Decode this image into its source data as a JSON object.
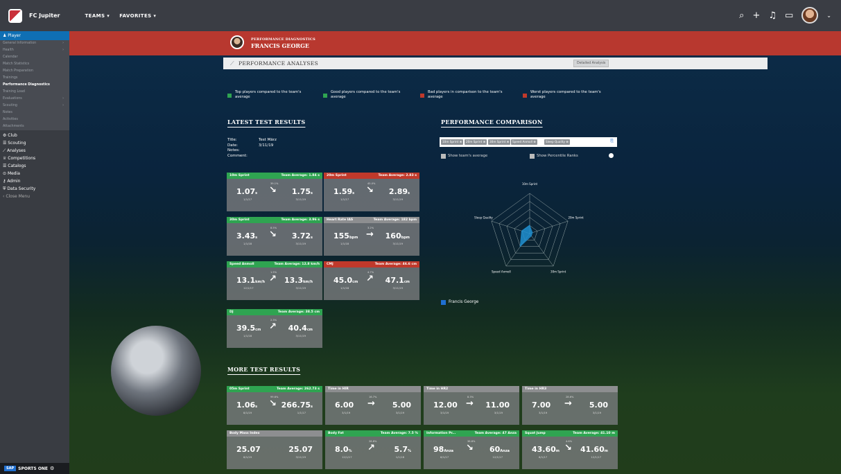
{
  "header": {
    "brand": "FC Jupiter",
    "nav": [
      "TEAMS ▾",
      "FAVORITES ▾"
    ],
    "icons": [
      "search-icon",
      "plus-icon",
      "whistle-icon",
      "chat-icon"
    ]
  },
  "sidebar": {
    "player_label": "Player",
    "sub": [
      "General Information",
      "Health",
      "Calendar",
      "Match Statistics",
      "Match Preparation",
      "Trainings",
      "Performance Diagnostics",
      "Training Load",
      "Evaluations",
      "Scouting",
      "Notes",
      "Activities",
      "Attachments"
    ],
    "main": [
      "Club",
      "Scouting",
      "Analyses",
      "Competitions",
      "Catalogs",
      "Media",
      "Admin",
      "Data Security",
      "Close Menu"
    ],
    "footer": "SPORTS ONE",
    "footer_logo": "SAP"
  },
  "banner": {
    "subtitle": "PERFORMANCE DIAGNOSTICS",
    "title": "FRANCIS GEORGE"
  },
  "subbar": {
    "title": "PERFORMANCE ANALYSES",
    "detail_button": "Detailed Analysis"
  },
  "legend": [
    {
      "color": "#2fa451",
      "text": "Top players compared to the team's average"
    },
    {
      "color": "#2fa451",
      "text": "Good players compared to the team's average"
    },
    {
      "color": "#c0392b",
      "text": "Bad players in comparison to the team's average"
    },
    {
      "color": "#c0392b",
      "text": "Worst players compared to the team's average"
    }
  ],
  "latest": {
    "title": "LATEST TEST RESULTS",
    "meta": [
      {
        "k": "Title:",
        "v": "Test März"
      },
      {
        "k": "Date:",
        "v": "3/11/19"
      },
      {
        "k": "Notes:",
        "v": ""
      },
      {
        "k": "Comment:",
        "v": ""
      }
    ]
  },
  "cards": [
    {
      "name": "10m Sprint",
      "avg": "Team Average: 1.84 s",
      "color": "green",
      "v1": "1.07",
      "u1": "s",
      "v2": "1.75",
      "u2": "s",
      "d1": "1/1/17",
      "d2": "3/11/19",
      "pct": "39.1%",
      "dir": "down"
    },
    {
      "name": "20m Sprint",
      "avg": "Team Average: 2.83 s",
      "color": "red",
      "v1": "1.59",
      "u1": "s",
      "v2": "2.89",
      "u2": "s",
      "d1": "1/1/17",
      "d2": "3/11/19",
      "pct": "45.0%",
      "dir": "down"
    },
    {
      "name": "30m Sprint",
      "avg": "Team Average: 3.96 s",
      "color": "green",
      "v1": "3.43",
      "u1": "s",
      "v2": "3.72",
      "u2": "s",
      "d1": "1/1/18",
      "d2": "3/11/19",
      "pct": "8.5%",
      "dir": "down"
    },
    {
      "name": "Heart Rate IAS",
      "avg": "Team Average: 182 bpm",
      "color": "gray",
      "v1": "155",
      "u1": "bpm",
      "v2": "160",
      "u2": "bpm",
      "d1": "1/1/18",
      "d2": "3/11/19",
      "pct": "3.2%",
      "dir": "flat"
    },
    {
      "name": "Speed Anmoll",
      "avg": "Team Average: 12.8 km/h",
      "color": "green",
      "v1": "13.1",
      "u1": "km/h",
      "v2": "13.3",
      "u2": "km/h",
      "d1": "12/1/17",
      "d2": "3/11/19",
      "pct": "1.5%",
      "dir": "up"
    },
    {
      "name": "CMJ",
      "avg": "Team Average: 46.6 cm",
      "color": "red",
      "v1": "45.0",
      "u1": "cm",
      "v2": "47.1",
      "u2": "cm",
      "d1": "1/1/18",
      "d2": "3/11/19",
      "pct": "4.7%",
      "dir": "up"
    },
    {
      "name": "DJ",
      "avg": "Team Average: 38.5 cm",
      "color": "green",
      "v1": "39.5",
      "u1": "cm",
      "v2": "40.4",
      "u2": "cm",
      "d1": "1/1/18",
      "d2": "3/11/19",
      "pct": "2.3%",
      "dir": "up"
    }
  ],
  "comparison": {
    "title": "PERFORMANCE COMPARISON",
    "chips": [
      "10m Sprint ⊗",
      "20m Sprint ⊗",
      "30m Sprint ⊗",
      "Speed Anmoll ⊗",
      "Sleep Quality ⊗"
    ],
    "show_avg": "Show team's average",
    "show_ranks": "Show Percentile Ranks",
    "axes": [
      "10m Sprint",
      "20m Sprint",
      "30m Sprint",
      "Speed Anmoll",
      "Sleep Quality"
    ],
    "values": [
      0.22,
      0.08,
      0.08,
      0.42,
      0.22
    ],
    "series_name": "Francis George",
    "series_color": "#1f8fd1"
  },
  "more": {
    "title": "MORE TEST RESULTS",
    "cards": [
      {
        "name": "05m Sprint",
        "avg": "Team Average: 262.73 s",
        "color": "green",
        "v1": "1.06",
        "u1": "s",
        "v2": "266.75",
        "u2": "s",
        "d1": "8/1/19",
        "d2": "1/1/17",
        "pct": "99.6%",
        "dir": "down"
      },
      {
        "name": "Time in HIR",
        "avg": "",
        "color": "gray",
        "v1": "6.00",
        "u1": "",
        "v2": "5.00",
        "u2": "",
        "d1": "3/1/19",
        "d2": "3/1/19",
        "pct": "16.7%",
        "dir": "flat"
      },
      {
        "name": "Time in HR2",
        "avg": "",
        "color": "gray",
        "v1": "12.00",
        "u1": "",
        "v2": "11.00",
        "u2": "",
        "d1": "3/1/19",
        "d2": "3/1/19",
        "pct": "8.3%",
        "dir": "flat"
      },
      {
        "name": "Time in HR3",
        "avg": "",
        "color": "gray",
        "v1": "7.00",
        "u1": "",
        "v2": "5.00",
        "u2": "",
        "d1": "3/1/19",
        "d2": "3/1/19",
        "pct": "28.6%",
        "dir": "flat"
      },
      {
        "name": "Body Mass Index",
        "avg": "",
        "color": "gray",
        "v1": "25.07",
        "u1": "",
        "v2": "25.07",
        "u2": "",
        "d1": "8/1/19",
        "d2": "3/11/19",
        "pct": "",
        "dir": "none"
      },
      {
        "name": "Body Fat",
        "avg": "Team Average: 7.5 %",
        "color": "green",
        "v1": "8.0",
        "u1": "%",
        "v2": "5.7",
        "u2": "%",
        "d1": "12/1/17",
        "d2": "1/1/18",
        "pct": "28.8%",
        "dir": "up"
      },
      {
        "name": "Information Pr...",
        "avg": "Team Average: 47 Anza",
        "color": "green",
        "v1": "98",
        "u1": "Anza",
        "v2": "60",
        "u2": "Anza",
        "d1": "6/1/17",
        "d2": "12/1/17",
        "pct": "38.8%",
        "dir": "down"
      },
      {
        "name": "Squat Jump",
        "avg": "Team Average: 41.10 m",
        "color": "green",
        "v1": "43.60",
        "u1": "m",
        "v2": "41.60",
        "u2": "m",
        "d1": "6/1/17",
        "d2": "12/1/17",
        "pct": "4.6%",
        "dir": "down"
      }
    ]
  }
}
